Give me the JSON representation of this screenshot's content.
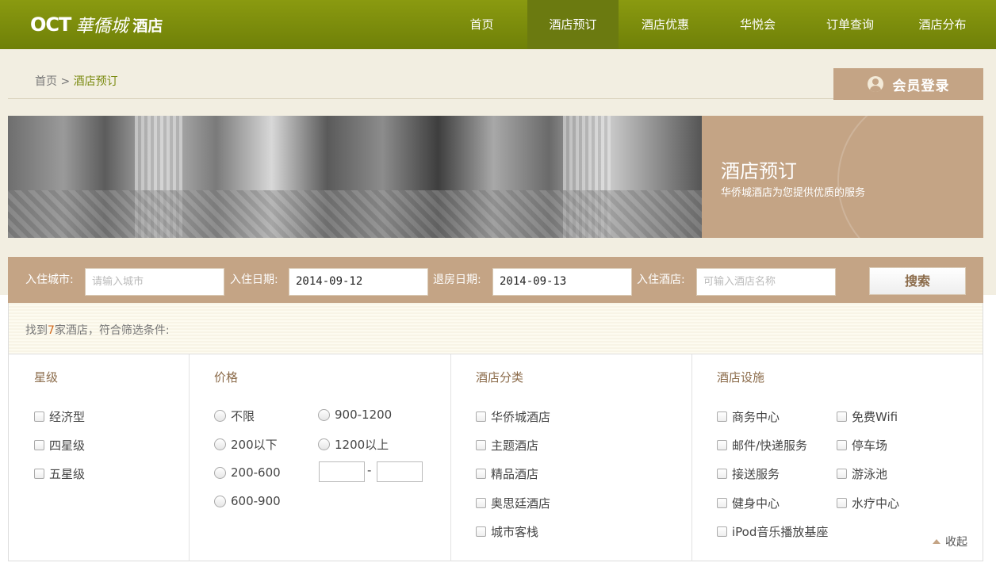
{
  "header": {
    "logo_oct": "OCT",
    "logo_script": "華僑城",
    "logo_hotel": "酒店",
    "nav": [
      {
        "label": "首页"
      },
      {
        "label": "酒店预订",
        "active": true
      },
      {
        "label": "酒店优惠"
      },
      {
        "label": "华悦会"
      },
      {
        "label": "订单查询"
      },
      {
        "label": "酒店分布"
      }
    ],
    "nav_color": "#7a8a0c"
  },
  "breadcrumb": {
    "home": "首页",
    "separator": " > ",
    "current": "酒店预订"
  },
  "login": {
    "label": "会员登录",
    "icon": "user-avatar-icon"
  },
  "banner": {
    "title": "酒店预订",
    "subtitle": "华侨城酒店为您提供优质的服务",
    "accent": "#c4a485"
  },
  "search": {
    "city_label": "入住城市:",
    "city_placeholder": "请输入城市",
    "checkin_label": "入住日期:",
    "checkin_value": "2014-09-12",
    "checkout_label": "退房日期:",
    "checkout_value": "2014-09-13",
    "hotel_label": "入住酒店:",
    "hotel_placeholder": "可输入酒店名称",
    "button": "搜索"
  },
  "result": {
    "prefix": "找到",
    "count": "7",
    "suffix": "家酒店，符合筛选条件:"
  },
  "filters": {
    "star": {
      "title": "星级",
      "options": [
        "经济型",
        "四星级",
        "五星级"
      ]
    },
    "price": {
      "title": "价格",
      "options": [
        "不限",
        "200以下",
        "200-600",
        "600-900",
        "900-1200",
        "1200以上"
      ],
      "range_dash": "-"
    },
    "category": {
      "title": "酒店分类",
      "options": [
        "华侨城酒店",
        "主题酒店",
        "精品酒店",
        "奥思廷酒店",
        "城市客栈"
      ]
    },
    "facility": {
      "title": "酒店设施",
      "options": [
        "商务中心",
        "免费Wifi",
        "邮件/快递服务",
        "停车场",
        "接送服务",
        "游泳池",
        "健身中心",
        "水疗中心",
        "iPod音乐播放基座"
      ]
    },
    "collapse_label": "收起"
  }
}
